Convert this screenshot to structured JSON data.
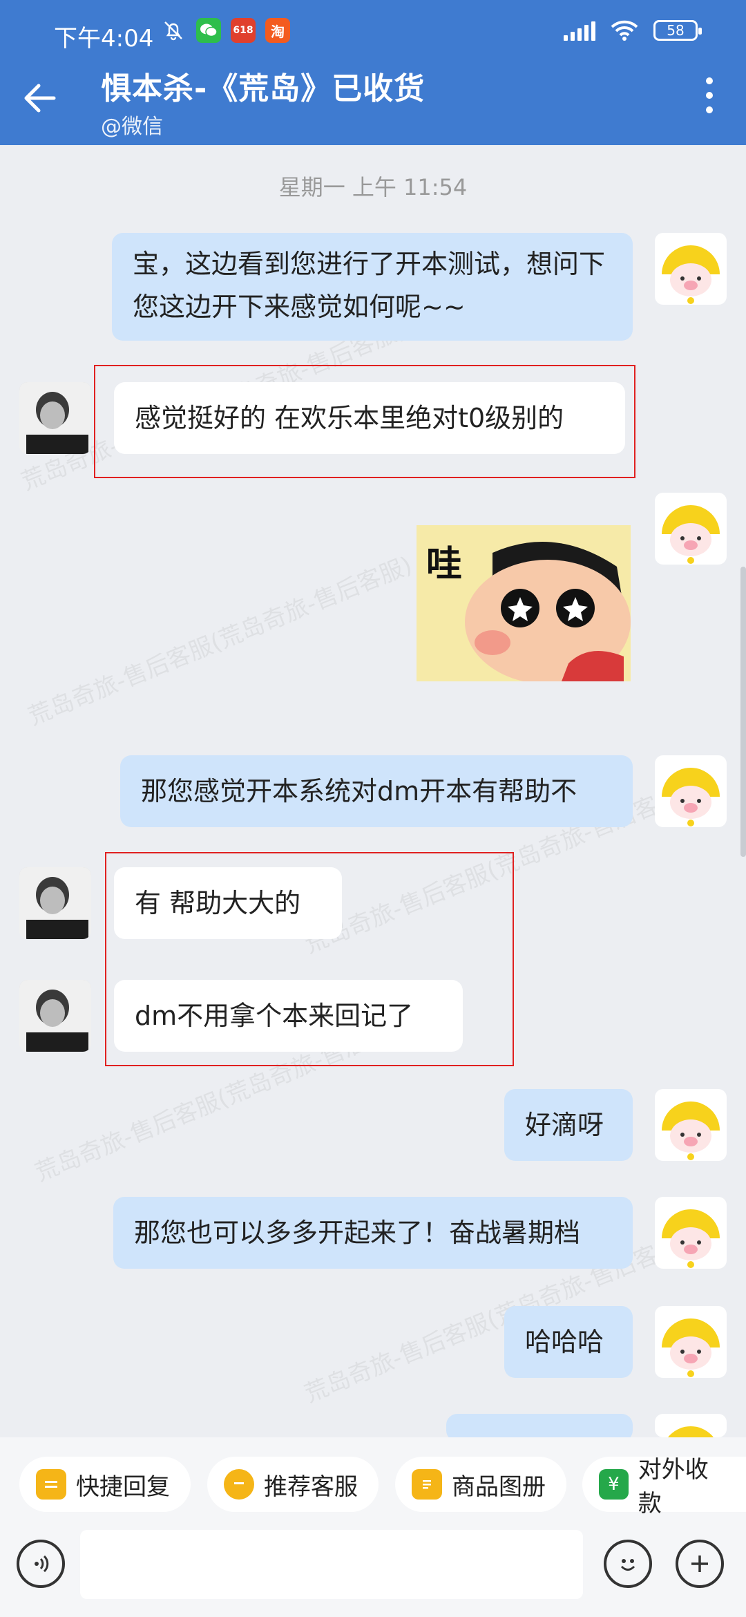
{
  "status_bar": {
    "time": "下午4:04",
    "battery": "58",
    "shop_icon_1_label": "618",
    "shop_icon_2_label": "淘"
  },
  "header": {
    "title": "惧本杀-《荒岛》已收货",
    "subtitle": "@微信"
  },
  "chat": {
    "timestamp": "星期一  上午 11:54",
    "messages": [
      {
        "from": "me",
        "text": "宝，这边看到您进行了开本测试，想问下您这边开下来感觉如何呢~~"
      },
      {
        "from": "them",
        "text": "感觉挺好的 在欢乐本里绝对t0级别的"
      },
      {
        "from": "me",
        "type": "sticker",
        "text": "哇"
      },
      {
        "from": "me",
        "text": "那您感觉开本系统对dm开本有帮助不"
      },
      {
        "from": "them",
        "text": "有 帮助大大的"
      },
      {
        "from": "them",
        "text": "dm不用拿个本来回记了"
      },
      {
        "from": "me",
        "text": "好滴呀"
      },
      {
        "from": "me",
        "text": "那您也可以多多开起来了！奋战暑期档"
      },
      {
        "from": "me",
        "text": "哈哈哈"
      }
    ],
    "watermark": "荒岛奇旅-售后客服(荒岛奇旅-售后客服)"
  },
  "toolbar": {
    "chips": [
      "快捷回复",
      "推荐客服",
      "商品图册",
      "对外收款"
    ]
  },
  "icons": {
    "back": "back-arrow-icon",
    "more": "more-vertical-icon",
    "voice": "voice-icon",
    "emoji": "emoji-icon",
    "add": "plus-icon"
  },
  "colors": {
    "header": "#3f7bd0",
    "my_bubble": "#cfe4fb",
    "their_bubble": "#ffffff",
    "background": "#eceef2",
    "highlight_box": "#e02020"
  }
}
